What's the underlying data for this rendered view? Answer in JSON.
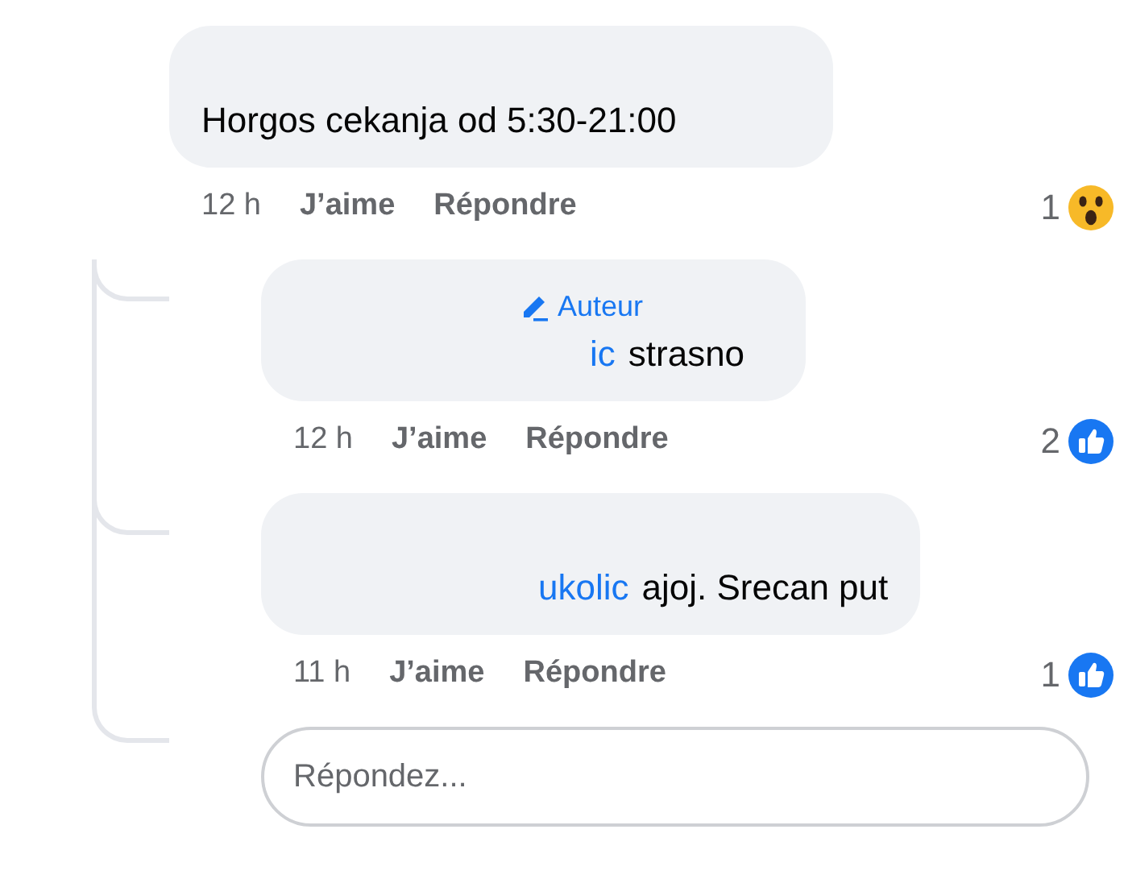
{
  "comment": {
    "text": "Horgos cekanja od 5:30-21:00",
    "time": "12 h",
    "like_label": "J’aime",
    "reply_label": "Répondre",
    "reaction": {
      "kind": "wow",
      "count": "1"
    }
  },
  "replies": [
    {
      "author_badge": "Auteur",
      "mention": "ic",
      "text": "strasno",
      "time": "12 h",
      "like_label": "J’aime",
      "reply_label": "Répondre",
      "reaction": {
        "kind": "like",
        "count": "2"
      }
    },
    {
      "mention": "ukolic",
      "text": "ajoj. Srecan put",
      "time": "11 h",
      "like_label": "J’aime",
      "reply_label": "Répondre",
      "reaction": {
        "kind": "like",
        "count": "1"
      }
    }
  ],
  "reply_box": {
    "placeholder": "Répondez..."
  }
}
